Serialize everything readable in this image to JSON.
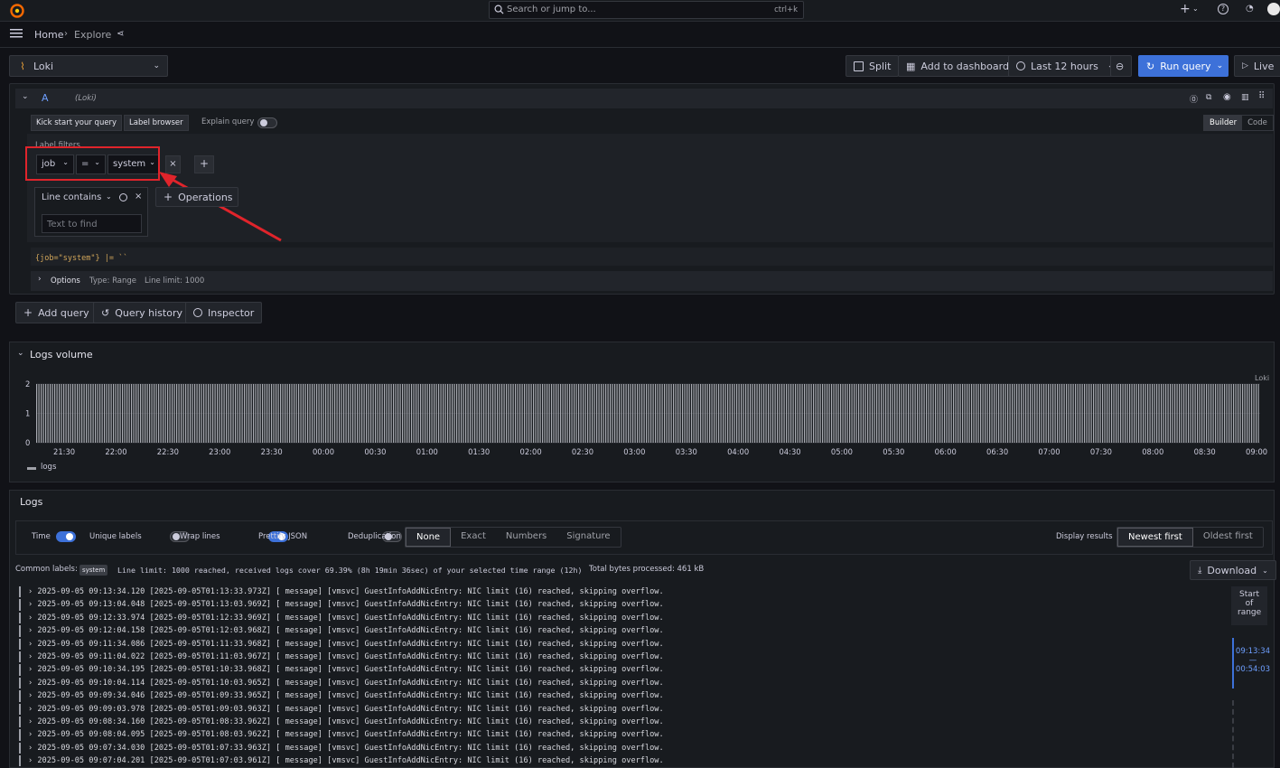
{
  "topbar": {
    "search_placeholder": "Search or jump to...",
    "search_shortcut": "ctrl+k"
  },
  "breadcrumb": {
    "home": "Home",
    "explore": "Explore"
  },
  "datasource": {
    "name": "Loki"
  },
  "toolbar": {
    "split": "Split",
    "add_to_dashboard": "Add to dashboard",
    "time_range": "Last 12 hours",
    "run_query": "Run query",
    "live": "Live"
  },
  "query": {
    "ref_id": "A",
    "datasource_hint": "(Loki)",
    "kick_start": "Kick start your query",
    "label_browser": "Label browser",
    "explain_query": "Explain query",
    "mode_builder": "Builder",
    "mode_code": "Code",
    "label_filters_title": "Label filters",
    "filter_label": "job",
    "filter_op": "=",
    "filter_value": "system",
    "line_op_title": "Line contains",
    "line_op_placeholder": "Text to find",
    "operations": "Operations",
    "raw_query": "{job=\"system\"} |= ``",
    "options_label": "Options",
    "options_type": "Type: Range",
    "options_limit": "Line limit: 1000"
  },
  "actions": {
    "add_query": "Add query",
    "query_history": "Query history",
    "inspector": "Inspector"
  },
  "logs_volume": {
    "title": "Logs volume",
    "datasource_label": "Loki",
    "legend": "logs"
  },
  "chart_data": {
    "type": "bar",
    "title": "Logs volume",
    "xlabel": "",
    "ylabel": "",
    "ylim": [
      0,
      2
    ],
    "y_ticks": [
      "0",
      "1",
      "2"
    ],
    "x_ticks": [
      "21:30",
      "22:00",
      "22:30",
      "23:00",
      "23:30",
      "00:00",
      "00:30",
      "01:00",
      "01:30",
      "02:00",
      "02:30",
      "03:00",
      "03:30",
      "04:00",
      "04:30",
      "05:00",
      "05:30",
      "06:00",
      "06:30",
      "07:00",
      "07:30",
      "08:00",
      "08:30",
      "09:00"
    ],
    "series": [
      {
        "name": "logs",
        "value_per_bucket": 2,
        "bucket_interval": "30s"
      }
    ],
    "grid": true,
    "legend": "bottom-left"
  },
  "logs": {
    "title": "Logs",
    "controls": {
      "time": "Time",
      "unique_labels": "Unique labels",
      "wrap_lines": "Wrap lines",
      "prettify_json": "Prettify JSON",
      "deduplication": "Deduplication",
      "dedup_options": [
        "None",
        "Exact",
        "Numbers",
        "Signature"
      ],
      "display_results": "Display results",
      "order_options": [
        "Newest first",
        "Oldest first"
      ]
    },
    "meta": {
      "common_labels": "Common labels:",
      "common_label_value": "system",
      "line_limit": "Line limit: 1000 reached, received logs cover 69.39% (8h 19min 36sec) of your selected time range (12h)",
      "bytes": "Total bytes processed: 461 kB"
    },
    "download": "Download",
    "range_start": "Start of range",
    "range_top": "09:13:34",
    "range_dash": "—",
    "range_bottom": "00:54:03",
    "lines": [
      "2025-09-05 09:13:34.120 [2025-09-05T01:13:33.973Z] [ message] [vmsvc] GuestInfoAddNicEntry: NIC limit (16) reached, skipping overflow.",
      "2025-09-05 09:13:04.048 [2025-09-05T01:13:03.969Z] [ message] [vmsvc] GuestInfoAddNicEntry: NIC limit (16) reached, skipping overflow.",
      "2025-09-05 09:12:33.974 [2025-09-05T01:12:33.969Z] [ message] [vmsvc] GuestInfoAddNicEntry: NIC limit (16) reached, skipping overflow.",
      "2025-09-05 09:12:04.158 [2025-09-05T01:12:03.968Z] [ message] [vmsvc] GuestInfoAddNicEntry: NIC limit (16) reached, skipping overflow.",
      "2025-09-05 09:11:34.086 [2025-09-05T01:11:33.968Z] [ message] [vmsvc] GuestInfoAddNicEntry: NIC limit (16) reached, skipping overflow.",
      "2025-09-05 09:11:04.022 [2025-09-05T01:11:03.967Z] [ message] [vmsvc] GuestInfoAddNicEntry: NIC limit (16) reached, skipping overflow.",
      "2025-09-05 09:10:34.195 [2025-09-05T01:10:33.968Z] [ message] [vmsvc] GuestInfoAddNicEntry: NIC limit (16) reached, skipping overflow.",
      "2025-09-05 09:10:04.114 [2025-09-05T01:10:03.965Z] [ message] [vmsvc] GuestInfoAddNicEntry: NIC limit (16) reached, skipping overflow.",
      "2025-09-05 09:09:34.046 [2025-09-05T01:09:33.965Z] [ message] [vmsvc] GuestInfoAddNicEntry: NIC limit (16) reached, skipping overflow.",
      "2025-09-05 09:09:03.978 [2025-09-05T01:09:03.963Z] [ message] [vmsvc] GuestInfoAddNicEntry: NIC limit (16) reached, skipping overflow.",
      "2025-09-05 09:08:34.160 [2025-09-05T01:08:33.962Z] [ message] [vmsvc] GuestInfoAddNicEntry: NIC limit (16) reached, skipping overflow.",
      "2025-09-05 09:08:04.095 [2025-09-05T01:08:03.962Z] [ message] [vmsvc] GuestInfoAddNicEntry: NIC limit (16) reached, skipping overflow.",
      "2025-09-05 09:07:34.030 [2025-09-05T01:07:33.963Z] [ message] [vmsvc] GuestInfoAddNicEntry: NIC limit (16) reached, skipping overflow.",
      "2025-09-05 09:07:04.201 [2025-09-05T01:07:03.961Z] [ message] [vmsvc] GuestInfoAddNicEntry: NIC limit (16) reached, skipping overflow."
    ]
  },
  "annotation": {
    "color": "#e0242b"
  },
  "colors": {
    "accent": "#3d71d9",
    "background": "#111217",
    "panel": "#181b1f"
  }
}
